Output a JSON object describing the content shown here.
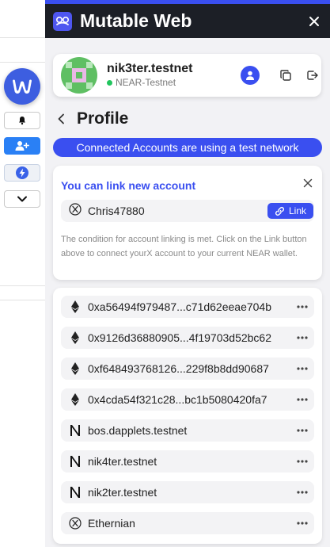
{
  "app": {
    "title": "Mutable Web",
    "accent": "#3a4ff0",
    "header_bg": "#1c1f26"
  },
  "account": {
    "name": "nik3ter.testnet",
    "network": "NEAR-Testnet",
    "status_color": "#22c55e"
  },
  "profile": {
    "title": "Profile"
  },
  "banner": {
    "text": "Connected Accounts are using a test network"
  },
  "link_card": {
    "title": "You can link new account",
    "account_name": "Chris47880",
    "account_icon": "x-icon",
    "link_label": "Link",
    "description": "The condition for account linking is met. Click on the Link button above to connect yourX account to your current NEAR wallet."
  },
  "connected_accounts": [
    {
      "icon": "ethereum-icon",
      "label": "0xa56494f979487...c71d62eeae704b"
    },
    {
      "icon": "ethereum-icon",
      "label": "0x9126d36880905...4f19703d52bc62"
    },
    {
      "icon": "ethereum-icon",
      "label": "0xf648493768126...229f8b8dd90687"
    },
    {
      "icon": "ethereum-icon",
      "label": "0x4cda54f321c28...bc1b5080420fa7"
    },
    {
      "icon": "near-icon",
      "label": "bos.dapplets.testnet"
    },
    {
      "icon": "near-icon",
      "label": "nik4ter.testnet"
    },
    {
      "icon": "near-icon",
      "label": "nik2ter.testnet"
    },
    {
      "icon": "x-icon",
      "label": "Ethernian"
    }
  ]
}
